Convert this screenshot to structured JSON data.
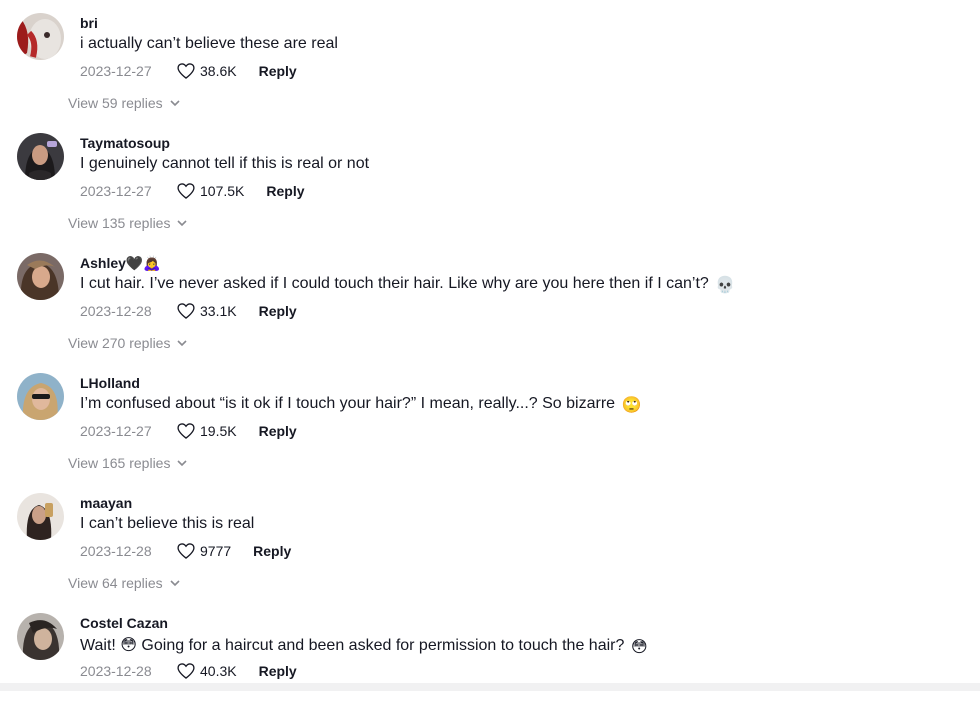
{
  "comments": [
    {
      "username": "bri",
      "text": "i actually can’t believe these are real",
      "date": "2023-12-27",
      "likes": "38.6K",
      "reply_label": "Reply",
      "view_replies": "View 59 replies"
    },
    {
      "username": "Taymatosoup",
      "text": "I genuinely cannot tell if this is real or not",
      "date": "2023-12-27",
      "likes": "107.5K",
      "reply_label": "Reply",
      "view_replies": "View 135 replies"
    },
    {
      "username": "Ashley🖤🙇‍♀️",
      "text": "I cut hair. I’ve never asked if I could touch their hair. Like why are you here then if I can’t?",
      "text_emoji": "💀",
      "date": "2023-12-28",
      "likes": "33.1K",
      "reply_label": "Reply",
      "view_replies": "View 270 replies"
    },
    {
      "username": "LHolland",
      "text": "I’m confused about “is it ok if I touch your hair?” I mean, really...? So bizarre",
      "text_emoji": "🙄",
      "date": "2023-12-27",
      "likes": "19.5K",
      "reply_label": "Reply",
      "view_replies": "View 165 replies"
    },
    {
      "username": "maayan",
      "text": "I can’t believe this is real",
      "date": "2023-12-28",
      "likes": "9777",
      "reply_label": "Reply",
      "view_replies": "View 64 replies"
    },
    {
      "username": "Costel Cazan",
      "text": "Wait! 😳 Going for a haircut and been asked for permission to touch the hair?",
      "text_emoji": "😳",
      "date": "2023-12-28",
      "likes": "40.3K",
      "reply_label": "Reply"
    }
  ],
  "icons": {
    "like": "heart-outline-icon",
    "expand": "chevron-down-icon"
  },
  "colors": {
    "text": "#161823",
    "muted": "#8a8b91"
  }
}
